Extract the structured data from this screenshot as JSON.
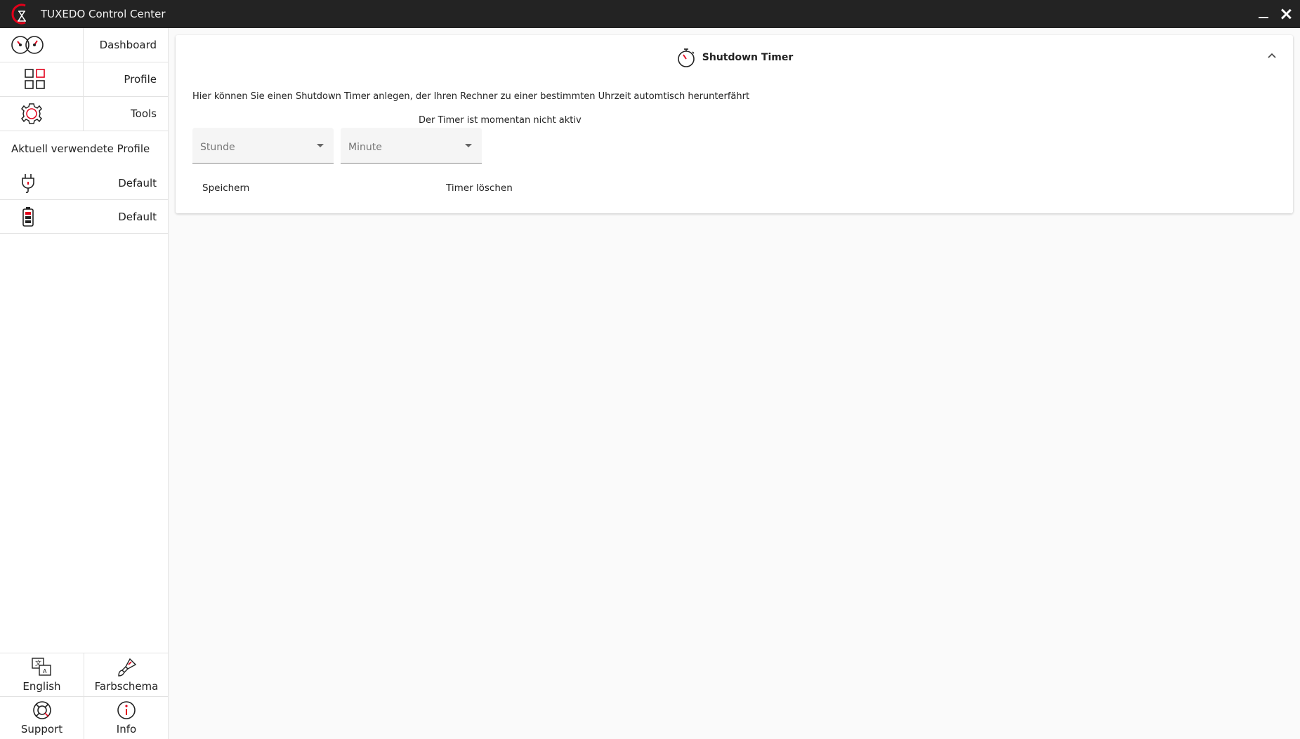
{
  "window": {
    "title": "TUXEDO Control Center"
  },
  "sidebar": {
    "nav": [
      {
        "label": "Dashboard",
        "icon": "speedometer-icon"
      },
      {
        "label": "Profile",
        "icon": "grid-icon"
      },
      {
        "label": "Tools",
        "icon": "gear-icon"
      }
    ],
    "section_title": "Aktuell verwendete Profile",
    "profiles": [
      {
        "label": "Default",
        "icon": "power-plug-icon"
      },
      {
        "label": "Default",
        "icon": "battery-icon"
      }
    ],
    "bottom": {
      "language": "English",
      "color_scheme": "Farbschema",
      "support": "Support",
      "info": "Info"
    }
  },
  "card": {
    "title": "Shutdown Timer",
    "description": "Hier können Sie einen Shutdown Timer anlegen, der Ihren Rechner zu einer bestimmten Uhrzeit automtisch herunterfährt",
    "status": "Der Timer ist momentan nicht aktiv",
    "hour_placeholder": "Stunde",
    "minute_placeholder": "Minute",
    "save_label": "Speichern",
    "clear_label": "Timer löschen"
  },
  "colors": {
    "accent": "#e2001a",
    "titlebar": "#232323"
  }
}
